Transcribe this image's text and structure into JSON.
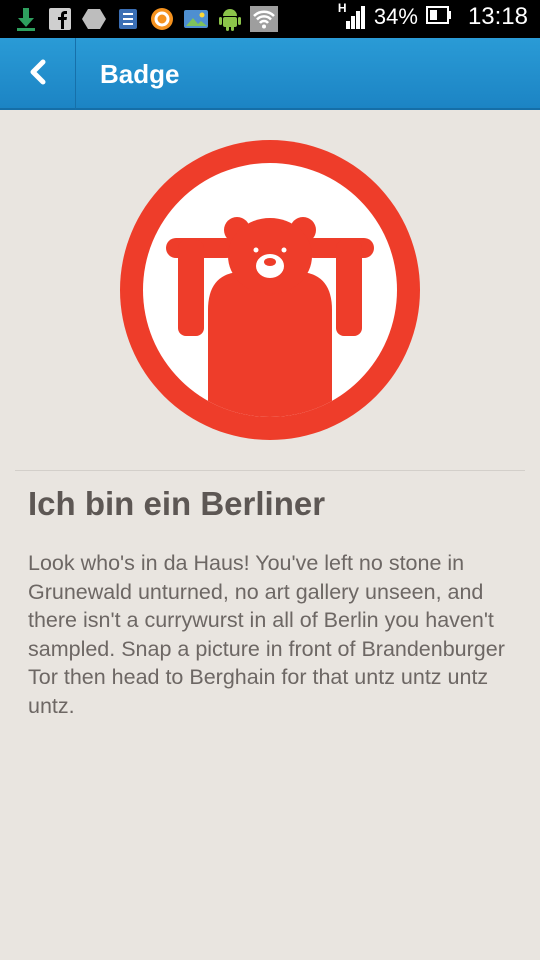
{
  "status_bar": {
    "network_type": "H",
    "battery": "34%",
    "time": "13:18",
    "icons": [
      "download-icon",
      "facebook-icon",
      "hexagon-app-icon",
      "sim-manager-icon",
      "avast-icon",
      "gallery-icon",
      "android-icon",
      "wifi-icon"
    ]
  },
  "action_bar": {
    "back_icon": "chevron-left-icon",
    "title": "Badge"
  },
  "badge": {
    "icon": "bear-badge-icon",
    "colors": {
      "accent": "#ee3d2a",
      "inner": "#ffffff"
    },
    "title": "Ich bin ein Berliner",
    "description": "Look who's in da Haus! You've left no stone in Grunewald unturned, no art gallery unseen, and there isn't a currywurst in all of Berlin you haven't sampled. Snap a picture in front of Brandenburger Tor then head to Berghain for that untz untz untz untz."
  }
}
